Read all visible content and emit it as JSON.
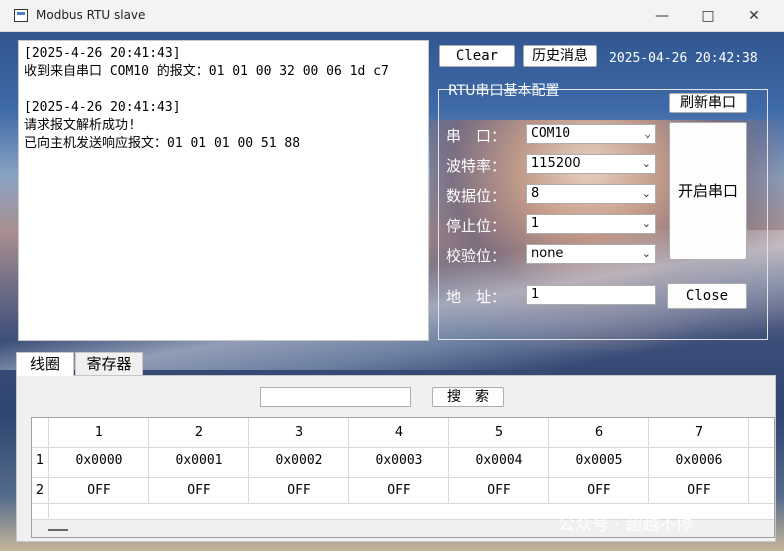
{
  "window": {
    "title": "Modbus RTU slave"
  },
  "log_lines": [
    "[2025-4-26 20:41:43]",
    "收到来自串口 COM10 的报文：01 01 00 32 00 06 1d c7",
    "",
    "[2025-4-26 20:41:43]",
    "请求报文解析成功!",
    "已向主机发送响应报文：01 01 01 00 51 88"
  ],
  "toolbar": {
    "clear_label": "Clear",
    "history_label": "历史消息",
    "timestamp": "2025-04-26 20:42:38"
  },
  "config": {
    "title": "RTU串口基本配置",
    "refresh_label": "刷新串口",
    "open_label": "开启串口",
    "close_label": "Close",
    "port_label": "串　口：",
    "port_value": "COM10",
    "baud_label": "波特率：",
    "baud_value": "115200",
    "databits_label": "数据位：",
    "databits_value": "8",
    "stopbits_label": "停止位：",
    "stopbits_value": "1",
    "parity_label": "校验位：",
    "parity_value": "none",
    "address_label": "地　址：",
    "address_value": "1"
  },
  "tabs": {
    "coil": "线圈",
    "register": "寄存器"
  },
  "search": {
    "button_label": "搜　索",
    "value": ""
  },
  "table": {
    "columns": [
      "1",
      "2",
      "3",
      "4",
      "5",
      "6",
      "7"
    ],
    "row_headers": [
      "1",
      "2"
    ],
    "rows": [
      [
        "0x0000",
        "0x0001",
        "0x0002",
        "0x0003",
        "0x0004",
        "0x0005",
        "0x0006"
      ],
      [
        "OFF",
        "OFF",
        "OFF",
        "OFF",
        "OFF",
        "OFF",
        "OFF"
      ]
    ]
  },
  "watermark": "公众号 · 超越不停"
}
